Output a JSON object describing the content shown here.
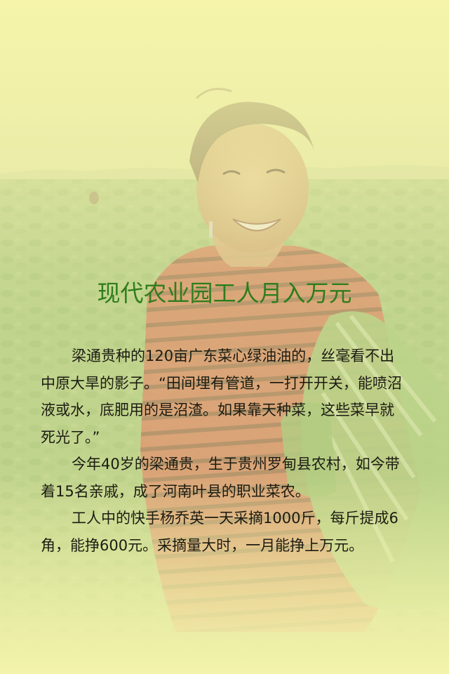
{
  "article": {
    "title": "现代农业园工人月入万元",
    "paragraphs": [
      "梁通贵种的120亩广东菜心绿油油的，丝毫看不出中原大旱的影子。“田间埋有管道，一打开开关，能喷沼液或水，底肥用的是沼渣。如果靠天种菜，这些菜早就死光了。”",
      "今年40岁的梁通贵，生于贵州罗甸县农村，如今带着15名亲戚，成了河南叶县的职业菜农。",
      "工人中的快手杨乔英一天采摘1000斤，每斤提成6角，能挣600元。采摘量大时，一月能挣上万元。"
    ]
  },
  "colors": {
    "background": "#f2f2a8",
    "title": "#2f7d1c",
    "text": "#1c1c12"
  }
}
